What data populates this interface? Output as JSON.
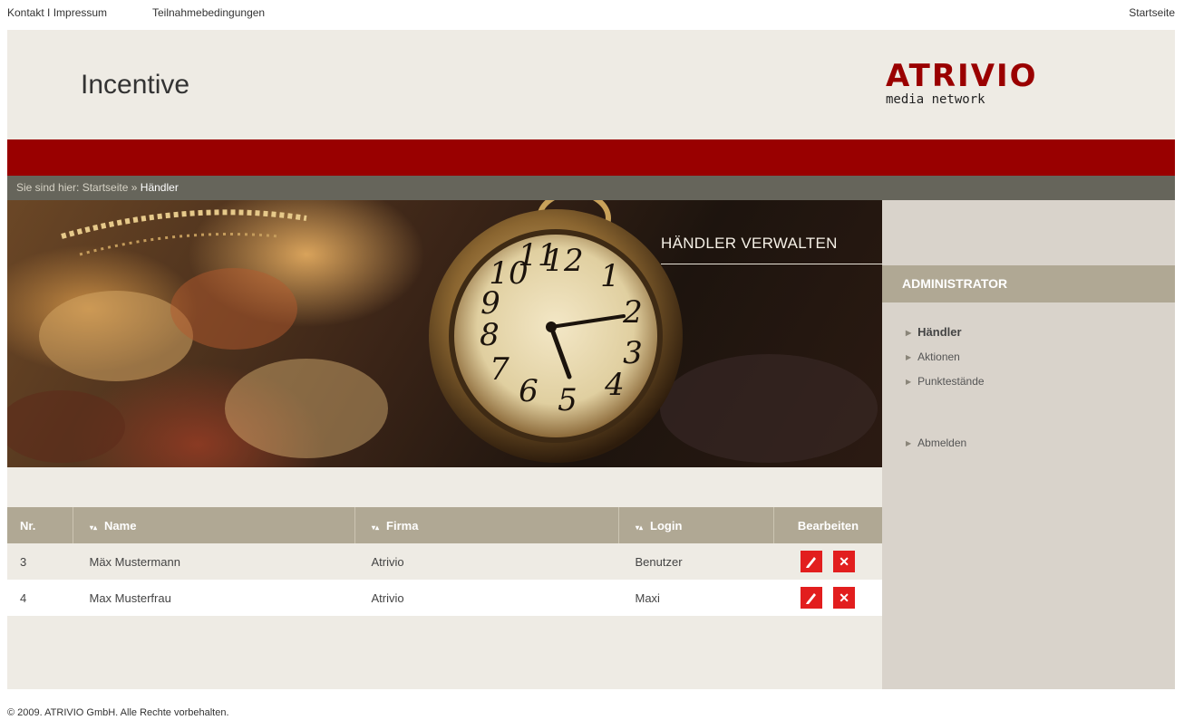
{
  "top_nav": {
    "contact": "Kontakt I Impressum",
    "terms": "Teilnahmebedingungen",
    "home": "Startseite"
  },
  "header": {
    "title": "Incentive",
    "logo_word": "ATRIVIO",
    "logo_sub": "media network"
  },
  "breadcrumb": {
    "prefix": "Sie sind hier:",
    "home": "Startseite",
    "separator": "»",
    "current": "Händler"
  },
  "hero": {
    "title": "HÄNDLER VERWALTEN"
  },
  "table": {
    "columns": {
      "nr": "Nr.",
      "name": "Name",
      "firma": "Firma",
      "login": "Login",
      "edit": "Bearbeiten"
    },
    "rows": [
      {
        "nr": "3",
        "name": "Mäx Mustermann",
        "firma": "Atrivio",
        "login": "Benutzer"
      },
      {
        "nr": "4",
        "name": "Max Musterfrau",
        "firma": "Atrivio",
        "login": "Maxi"
      }
    ]
  },
  "sidebar": {
    "heading": "ADMINISTRATOR",
    "items": [
      {
        "label": "Händler"
      },
      {
        "label": "Aktionen"
      },
      {
        "label": "Punktestände"
      },
      {
        "label": "Abmelden"
      }
    ]
  },
  "footer": {
    "copyright": "© 2009. ATRIVIO GmbH. Alle Rechte vorbehalten."
  },
  "colors": {
    "brand_red": "#990000",
    "button_red": "#e21e1e",
    "header_bg": "#eeebe4",
    "table_head": "#b0a894",
    "sidebar_bg": "#d9d3cb",
    "breadcrumb_bg": "#66655b"
  },
  "icons": {
    "sort": "sort-arrows-icon",
    "edit": "pencil-icon",
    "delete": "close-icon",
    "nav_arrow": "triangle-right-icon"
  }
}
